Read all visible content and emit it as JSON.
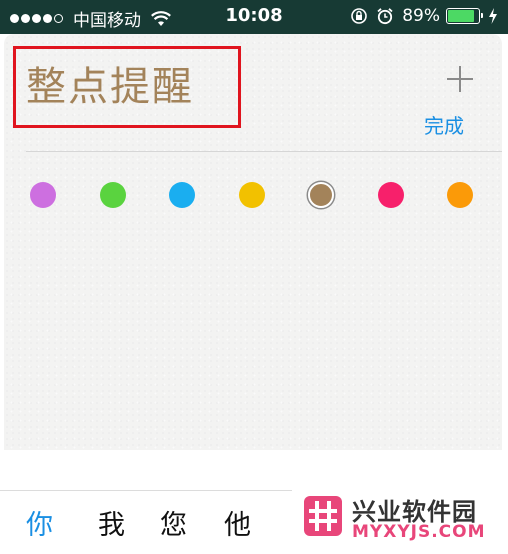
{
  "status_bar": {
    "carrier": "中国移动",
    "time": "10:08",
    "battery_percent": "89%",
    "battery_level": 0.89,
    "signal_bars_filled": 4,
    "signal_bars_total": 5,
    "icons": [
      "wifi-icon",
      "rotation-lock-icon",
      "alarm-icon",
      "battery-icon",
      "charging-icon"
    ]
  },
  "list": {
    "title": "整点提醒",
    "done_label": "完成",
    "add_icon": "plus-icon",
    "title_color": "#a3835a",
    "accent_color": "#1a8fe3",
    "highlight_color": "#e0141e",
    "colors": [
      {
        "name": "purple",
        "hex": "#cd6fe0",
        "selected": false
      },
      {
        "name": "green",
        "hex": "#5ad33f",
        "selected": false
      },
      {
        "name": "blue",
        "hex": "#1aaef0",
        "selected": false
      },
      {
        "name": "yellow",
        "hex": "#f2c100",
        "selected": false
      },
      {
        "name": "brown",
        "hex": "#a3835a",
        "selected": true
      },
      {
        "name": "pink",
        "hex": "#f7206b",
        "selected": false
      },
      {
        "name": "orange",
        "hex": "#fb9a08",
        "selected": false
      }
    ]
  },
  "keyboard": {
    "suggestions": [
      "你",
      "我",
      "您",
      "他"
    ],
    "active_index": 0
  },
  "watermark": {
    "title": "兴业软件园",
    "subtitle": "MYXYJS.COM",
    "logo_color": "#e8467a"
  }
}
